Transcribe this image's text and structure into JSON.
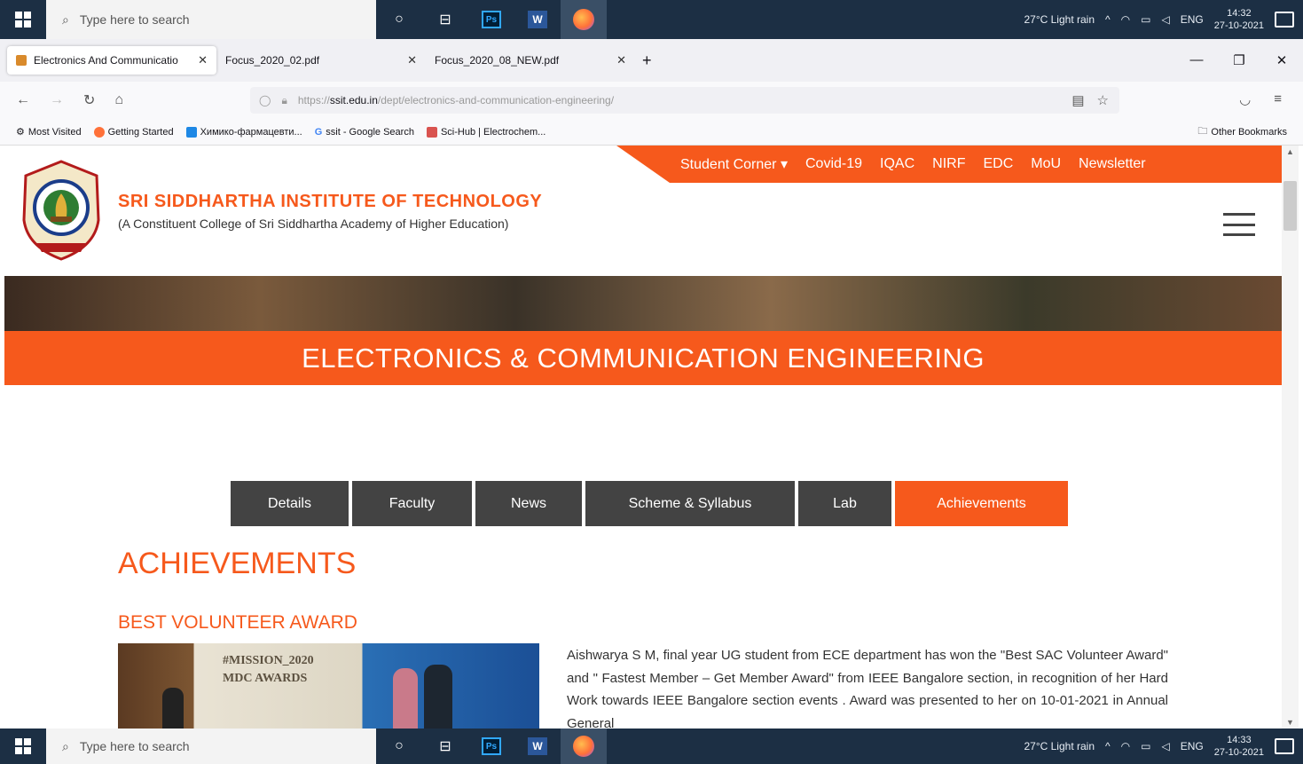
{
  "taskbar": {
    "search_placeholder": "Type here to search",
    "weather": "27°C  Light rain",
    "lang": "ENG",
    "time_top": "14:32",
    "date": "27-10-2021",
    "time_bottom": "14:33",
    "ps_label": "Ps",
    "word_label": "W"
  },
  "browser": {
    "tabs": [
      {
        "title": "Electronics And Communicatio"
      },
      {
        "title": "Focus_2020_02.pdf"
      },
      {
        "title": "Focus_2020_08_NEW.pdf"
      }
    ],
    "url_prefix": "https://",
    "url_host": "ssit.edu.in",
    "url_path": "/dept/electronics-and-communication-engineering/",
    "bookmarks": [
      {
        "label": "Most Visited",
        "color": "#777777"
      },
      {
        "label": "Getting Started",
        "color": "#ff7139"
      },
      {
        "label": "Химико-фармацевти...",
        "color": "#1e88e5"
      },
      {
        "label": "ssit - Google Search",
        "color": "#4285f4"
      },
      {
        "label": "Sci-Hub | Electrochem...",
        "color": "#d9534f"
      }
    ],
    "other_bookmarks": "Other Bookmarks"
  },
  "site": {
    "top_nav": [
      "Student Corner ▾",
      "Covid-19",
      "IQAC",
      "NIRF",
      "EDC",
      "MoU",
      "Newsletter"
    ],
    "name": "SRI SIDDHARTHA INSTITUTE OF TECHNOLOGY",
    "subtitle": "(A Constituent College of Sri Siddhartha Academy of Higher Education)",
    "dept_title": "ELECTRONICS & COMMUNICATION ENGINEERING",
    "dept_tabs": [
      {
        "label": "Details"
      },
      {
        "label": "Faculty"
      },
      {
        "label": "News"
      },
      {
        "label": "Scheme & Syllabus"
      },
      {
        "label": "Lab"
      },
      {
        "label": "Achievements"
      }
    ],
    "section_title": "ACHIEVEMENTS",
    "award_title": "BEST VOLUNTEER AWARD",
    "photo_caption_1": "#MISSION_2020",
    "photo_caption_2": "MDC AWARDS",
    "award_text": "Aishwarya S M, final year UG student from ECE department has won the \"Best SAC Volunteer Award\" and \" Fastest Member – Get Member Award\" from IEEE Bangalore section, in recognition of her Hard Work towards IEEE Bangalore section events . Award was presented to her on 10-01-2021 in Annual General",
    "accent_color": "#f6591c"
  }
}
